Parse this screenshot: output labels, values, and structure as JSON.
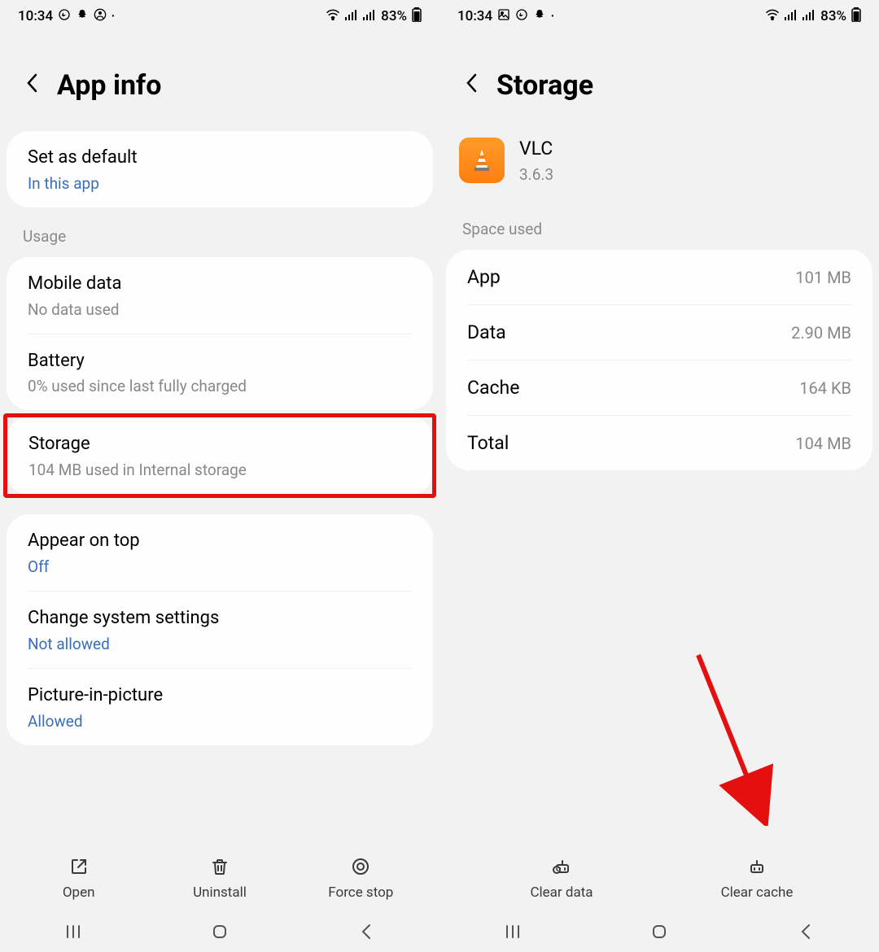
{
  "left": {
    "status": {
      "time": "10:34",
      "battery": "83%"
    },
    "title": "App info",
    "default": {
      "title": "Set as default",
      "sub": "In this app"
    },
    "usage_label": "Usage",
    "mobile": {
      "title": "Mobile data",
      "sub": "No data used"
    },
    "battery": {
      "title": "Battery",
      "sub": "0% used since last fully charged"
    },
    "storage": {
      "title": "Storage",
      "sub": "104 MB used in Internal storage"
    },
    "appear": {
      "title": "Appear on top",
      "sub": "Off"
    },
    "change": {
      "title": "Change system settings",
      "sub": "Not allowed"
    },
    "pip": {
      "title": "Picture-in-picture",
      "sub": "Allowed"
    },
    "actions": {
      "open": "Open",
      "uninstall": "Uninstall",
      "force_stop": "Force stop"
    }
  },
  "right": {
    "status": {
      "time": "10:34",
      "battery": "83%"
    },
    "title": "Storage",
    "app": {
      "name": "VLC",
      "version": "3.6.3"
    },
    "space_label": "Space used",
    "rows": {
      "app": {
        "k": "App",
        "v": "101 MB"
      },
      "data": {
        "k": "Data",
        "v": "2.90 MB"
      },
      "cache": {
        "k": "Cache",
        "v": "164 KB"
      },
      "total": {
        "k": "Total",
        "v": "104 MB"
      }
    },
    "actions": {
      "clear_data": "Clear data",
      "clear_cache": "Clear cache"
    }
  }
}
